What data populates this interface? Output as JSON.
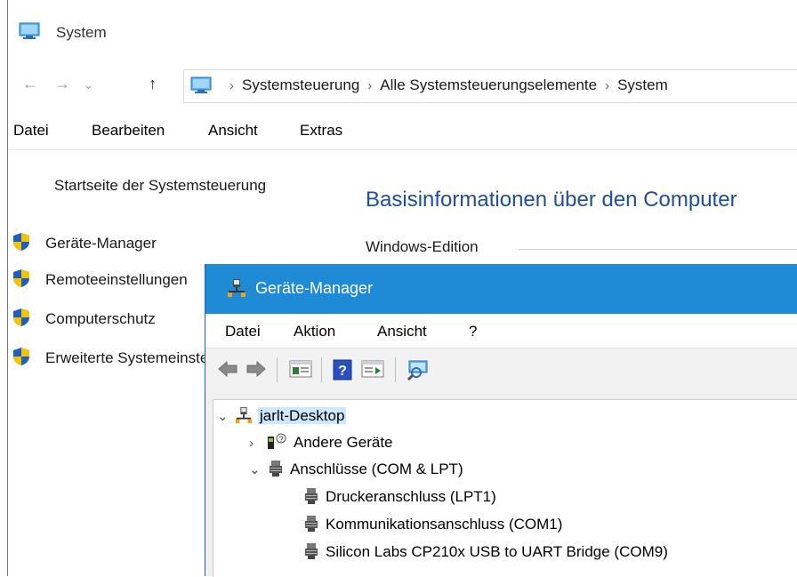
{
  "system_window": {
    "title": "System",
    "breadcrumbs": [
      "Systemsteuerung",
      "Alle Systemsteuerungselemente",
      "System"
    ],
    "menu": [
      "Datei",
      "Bearbeiten",
      "Ansicht",
      "Extras"
    ],
    "sidebar": {
      "home": "Startseite der Systemsteuerung",
      "items": [
        "Geräte-Manager",
        "Remoteeinstellungen",
        "Computerschutz",
        "Erweiterte Systemeinstellungen"
      ]
    },
    "heading": "Basisinformationen über den Computer",
    "edition_label": "Windows-Edition"
  },
  "device_manager": {
    "title": "Geräte-Manager",
    "menu": [
      "Datei",
      "Aktion",
      "Ansicht",
      "?"
    ],
    "tree": {
      "root": "jarlt-Desktop",
      "nodes": [
        "Andere Geräte",
        "Anschlüsse (COM & LPT)"
      ],
      "ports": [
        "Druckeranschluss (LPT1)",
        "Kommunikationsanschluss (COM1)",
        "Silicon Labs CP210x USB to UART Bridge (COM9)"
      ]
    }
  },
  "colors": {
    "accent": "#1f8ad6",
    "heading": "#1e4e9c",
    "selection": "#cce8ff",
    "shield_blue": "#1c5fbf",
    "shield_yellow": "#f5c400"
  },
  "icons": [
    "monitor-icon",
    "back-arrow-icon",
    "forward-arrow-icon",
    "up-arrow-icon",
    "shield-icon",
    "network-computer-icon",
    "port-icon",
    "unknown-device-icon",
    "help-icon",
    "scan-hardware-icon"
  ]
}
